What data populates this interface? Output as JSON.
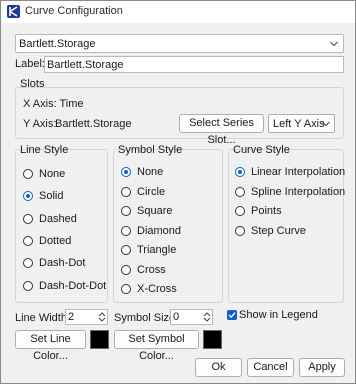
{
  "window": {
    "title": "Curve Configuration"
  },
  "series_selector": {
    "value": "Bartlett.Storage"
  },
  "label": {
    "caption": "Label:",
    "value": "Bartlett.Storage"
  },
  "slots": {
    "title": "Slots",
    "x_axis": "X Axis: Time",
    "y_axis_caption": "Y Axis:",
    "y_axis_value": "Bartlett.Storage",
    "select_button": "Select Series Slot...",
    "axis_select": "Left Y Axis"
  },
  "line_style": {
    "title": "Line Style",
    "options": [
      "None",
      "Solid",
      "Dashed",
      "Dotted",
      "Dash-Dot",
      "Dash-Dot-Dot"
    ],
    "selected": "Solid"
  },
  "symbol_style": {
    "title": "Symbol Style",
    "options": [
      "None",
      "Circle",
      "Square",
      "Diamond",
      "Triangle",
      "Cross",
      "X-Cross"
    ],
    "selected": "None"
  },
  "curve_style": {
    "title": "Curve Style",
    "options": [
      "Linear Interpolation",
      "Spline Interpolation",
      "Points",
      "Step Curve"
    ],
    "selected": "Linear Interpolation"
  },
  "line_width": {
    "caption": "Line Width",
    "value": "2"
  },
  "symbol_size": {
    "caption": "Symbol Size",
    "value": "0"
  },
  "show_in_legend": {
    "label": "Show in Legend",
    "checked": true
  },
  "buttons": {
    "line_color": "Set Line Color...",
    "symbol_color": "Set Symbol Color...",
    "ok": "Ok",
    "cancel": "Cancel",
    "apply": "Apply"
  },
  "colors": {
    "accent": "#0b5fc7",
    "line_color": "#000000",
    "symbol_color": "#000000"
  }
}
